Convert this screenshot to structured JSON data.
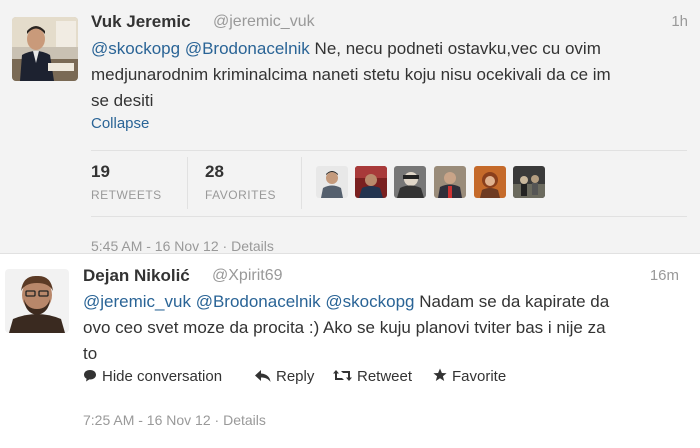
{
  "tweet1": {
    "name": "Vuk Jeremic",
    "handle": "@jeremic_vuk",
    "time": "1h",
    "text_mention_1": "@skockopg",
    "text_mention_2": "@Brodonacelnik",
    "text_body_1": " Ne, necu podneti ostavku,vec cu ovim",
    "text_line_2": "medjunarodnim kriminalcima naneti stetu koju nisu ocekivali da ce im",
    "text_line_3": "se desiti",
    "collapse_label": "Collapse",
    "retweets_count": "19",
    "retweets_label": "RETWEETS",
    "favorites_count": "28",
    "favorites_label": "FAVORITES",
    "timestamp": "5:45 AM - 16 Nov 12",
    "separator": "·",
    "details_label": "Details"
  },
  "tweet2": {
    "name": "Dejan Nikolić",
    "handle": "@Xpirit69",
    "time": "16m",
    "text_mention_1": "@jeremic_vuk",
    "text_mention_2": "@Brodonacelnik",
    "text_mention_3": "@skockopg",
    "text_body_1": " Nadam se da kapirate da",
    "text_line_2": "ovo ceo svet moze da procita :) Ako se kuju planovi tviter bas i nije za",
    "text_line_3": "to",
    "actions": {
      "hide": "Hide conversation",
      "reply": "Reply",
      "retweet": "Retweet",
      "favorite": "Favorite"
    },
    "timestamp": "7:25 AM - 16 Nov 12",
    "separator": "·",
    "details_label": "Details"
  },
  "colors": {
    "link": "#2a6496",
    "muted": "#999999",
    "focused_bg": "#f3f3f3"
  }
}
